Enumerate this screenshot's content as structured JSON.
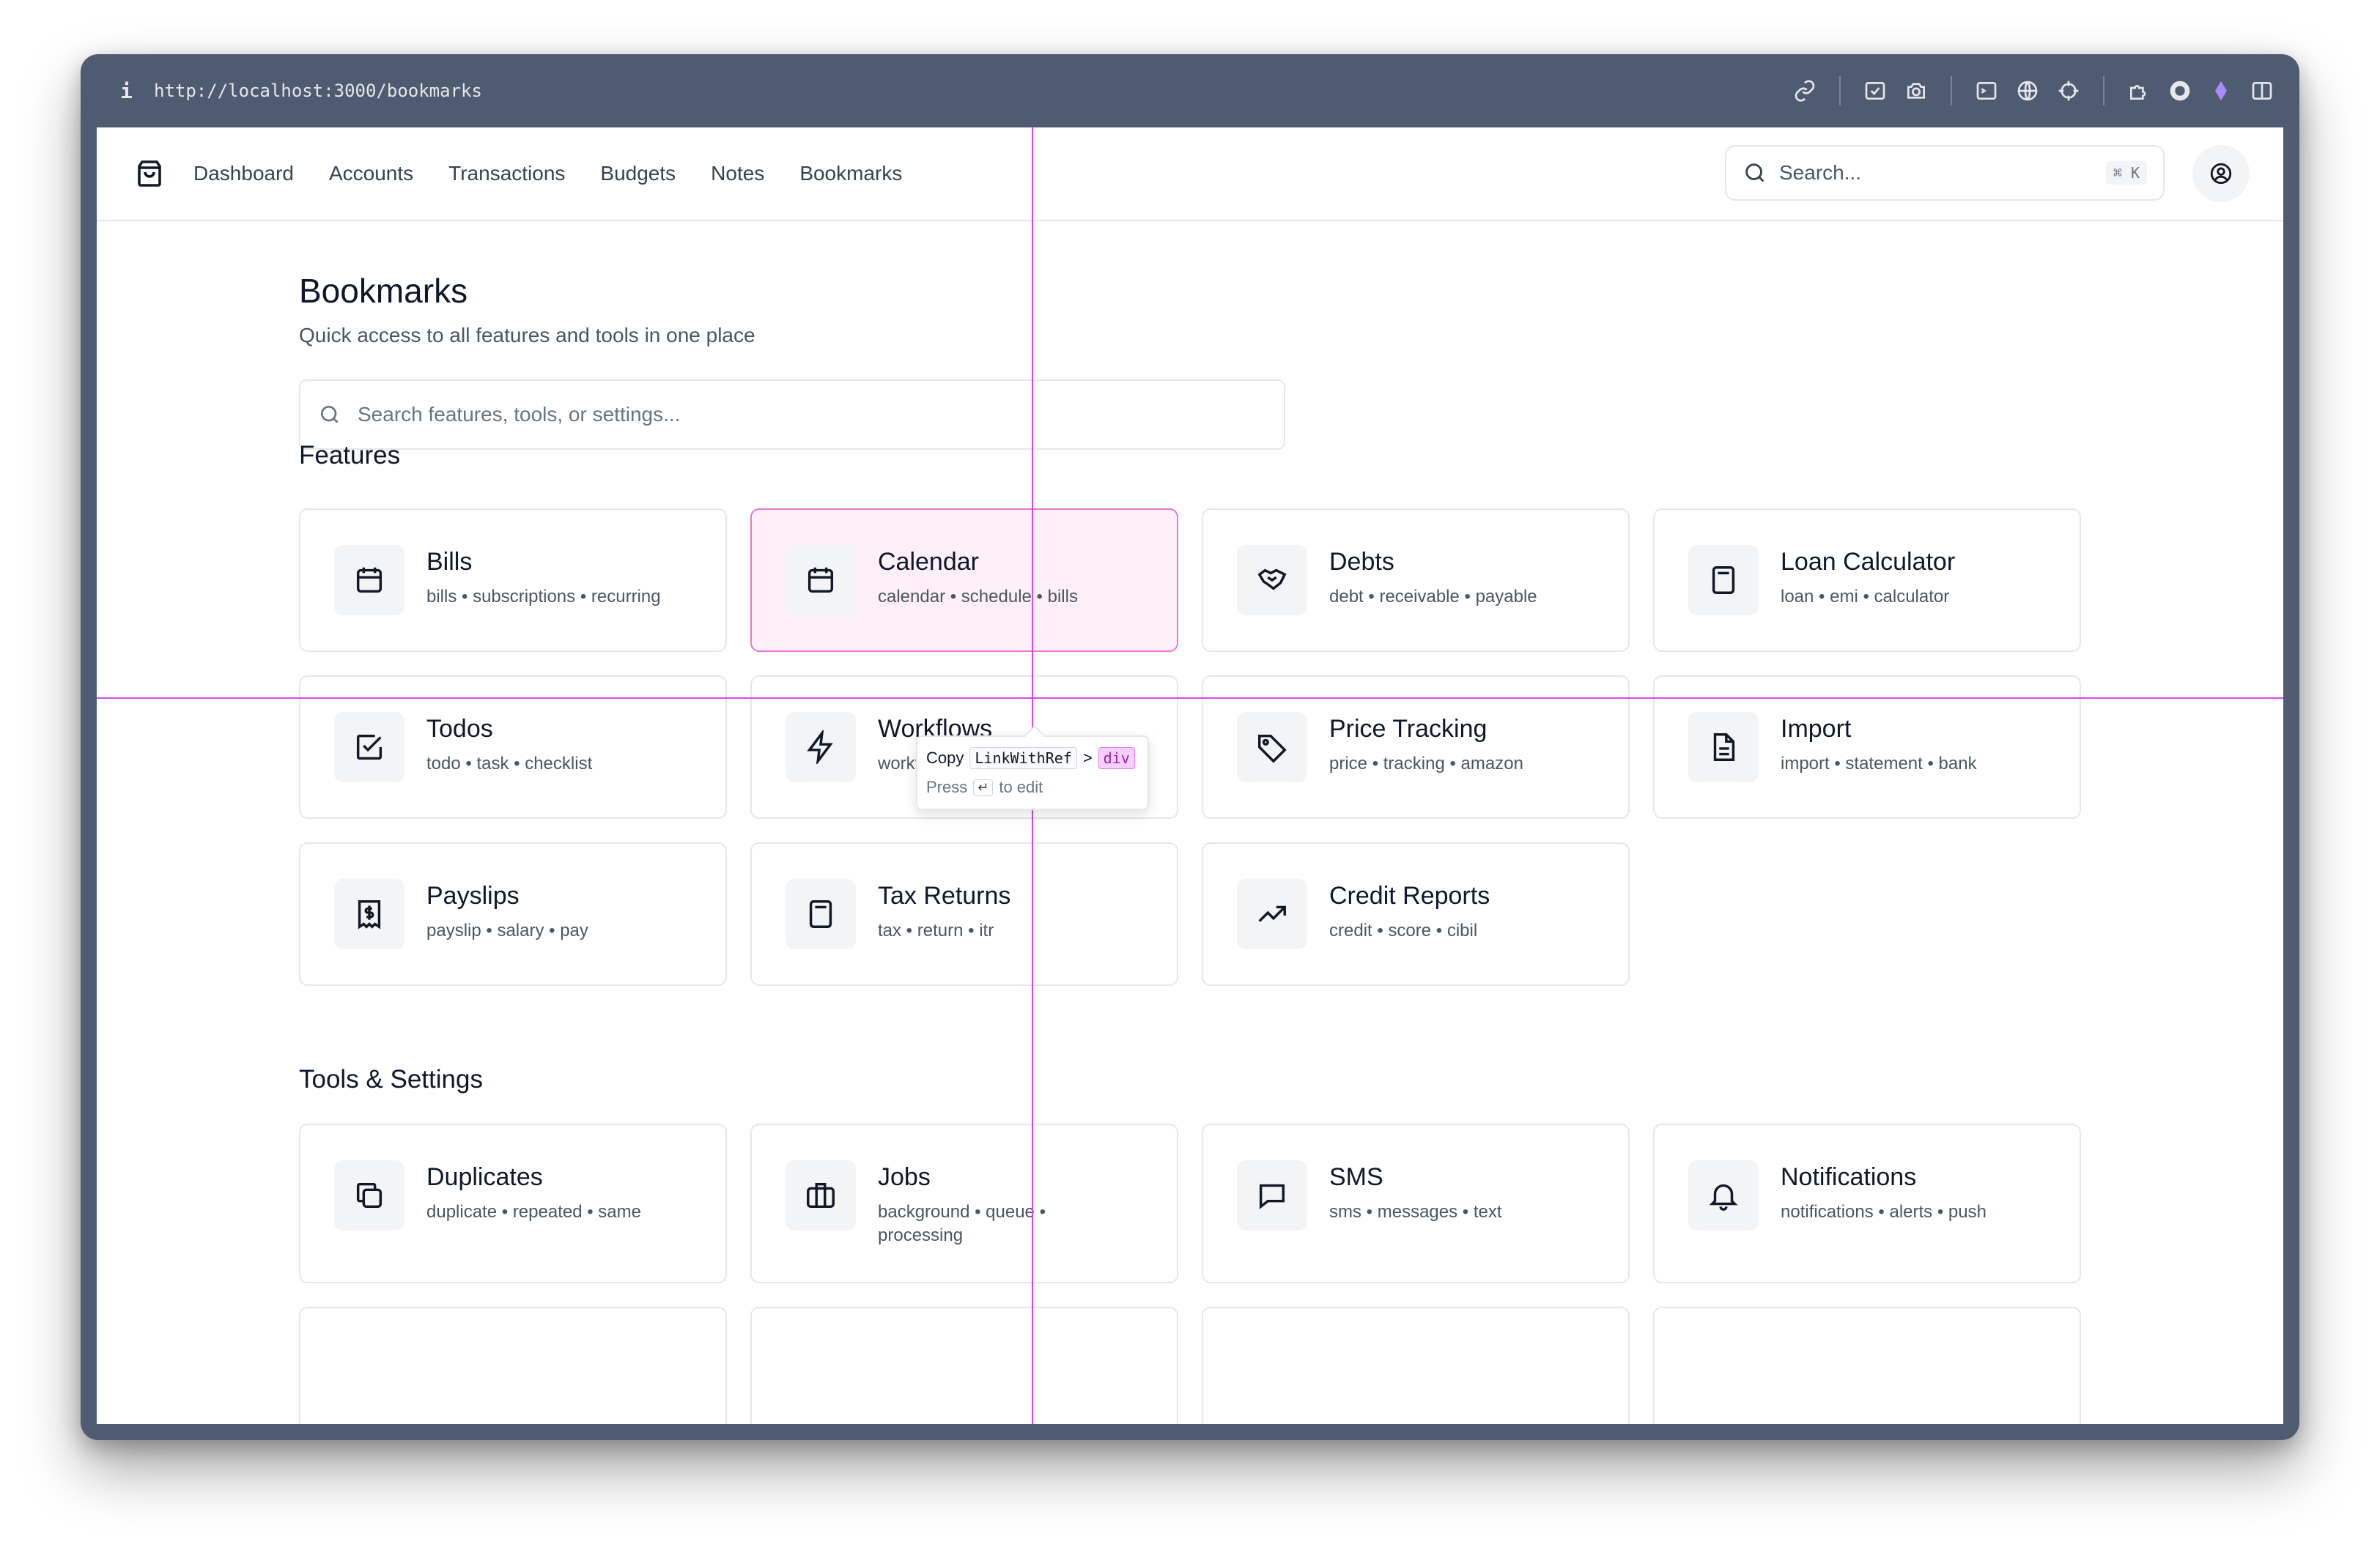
{
  "browser": {
    "info_glyph": "i",
    "url": "http://localhost:3000/bookmarks"
  },
  "nav": {
    "links": [
      "Dashboard",
      "Accounts",
      "Transactions",
      "Budgets",
      "Notes",
      "Bookmarks"
    ],
    "search_placeholder": "Search...",
    "search_shortcut": "⌘ K"
  },
  "page": {
    "title": "Bookmarks",
    "subtitle": "Quick access to all features and tools in one place",
    "search_placeholder": "Search features, tools, or settings..."
  },
  "features": {
    "heading": "Features",
    "items": [
      {
        "title": "Bills",
        "tags": "bills • subscriptions • recurring",
        "icon": "calendar-icon"
      },
      {
        "title": "Calendar",
        "tags": "calendar • schedule • bills",
        "icon": "calendar-grid-icon"
      },
      {
        "title": "Debts",
        "tags": "debt • receivable • payable",
        "icon": "handshake-icon"
      },
      {
        "title": "Loan Calculator",
        "tags": "loan • emi • calculator",
        "icon": "calculator-icon"
      },
      {
        "title": "Todos",
        "tags": "todo • task • checklist",
        "icon": "checkbox-icon"
      },
      {
        "title": "Workflows",
        "tags": "workflow • automation • zapier",
        "icon": "lightning-icon"
      },
      {
        "title": "Price Tracking",
        "tags": "price • tracking • amazon",
        "icon": "tag-icon"
      },
      {
        "title": "Import",
        "tags": "import • statement • bank",
        "icon": "document-icon"
      },
      {
        "title": "Payslips",
        "tags": "payslip • salary • pay",
        "icon": "receipt-dollar-icon"
      },
      {
        "title": "Tax Returns",
        "tags": "tax • return • itr",
        "icon": "calculator-icon"
      },
      {
        "title": "Credit Reports",
        "tags": "credit • score • cibil",
        "icon": "trending-up-icon"
      }
    ]
  },
  "tools": {
    "heading": "Tools & Settings",
    "items": [
      {
        "title": "Duplicates",
        "tags": "duplicate • repeated • same",
        "icon": "copy-icon"
      },
      {
        "title": "Jobs",
        "tags": "background • queue • processing",
        "icon": "briefcase-icon"
      },
      {
        "title": "SMS",
        "tags": "sms • messages • text",
        "icon": "message-icon"
      },
      {
        "title": "Notifications",
        "tags": "notifications • alerts • push",
        "icon": "bell-icon"
      }
    ]
  },
  "inspector": {
    "copy_label": "Copy",
    "component": "LinkWithRef",
    "separator": ">",
    "element": "div",
    "hint_prefix": "Press",
    "hint_key": "↵",
    "hint_suffix": "to edit"
  },
  "colors": {
    "highlight_bg": "#fdf0f8",
    "highlight_border": "#e879c9",
    "guide_line": "#d946ef"
  }
}
